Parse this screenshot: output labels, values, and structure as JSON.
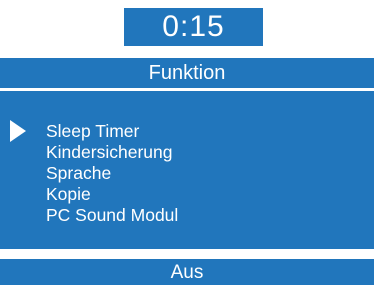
{
  "timer": {
    "value": "0:15"
  },
  "header": {
    "title": "Funktion"
  },
  "menu": {
    "selected_index": 0,
    "pointer_icon": "triangle-right",
    "items": [
      {
        "label": "Sleep Timer"
      },
      {
        "label": "Kindersicherung"
      },
      {
        "label": "Sprache"
      },
      {
        "label": "Kopie"
      },
      {
        "label": "PC Sound Modul"
      }
    ]
  },
  "footer": {
    "value": "Aus"
  },
  "colors": {
    "panel": "#2176bc",
    "text": "#ffffff",
    "background": "#ffffff"
  }
}
